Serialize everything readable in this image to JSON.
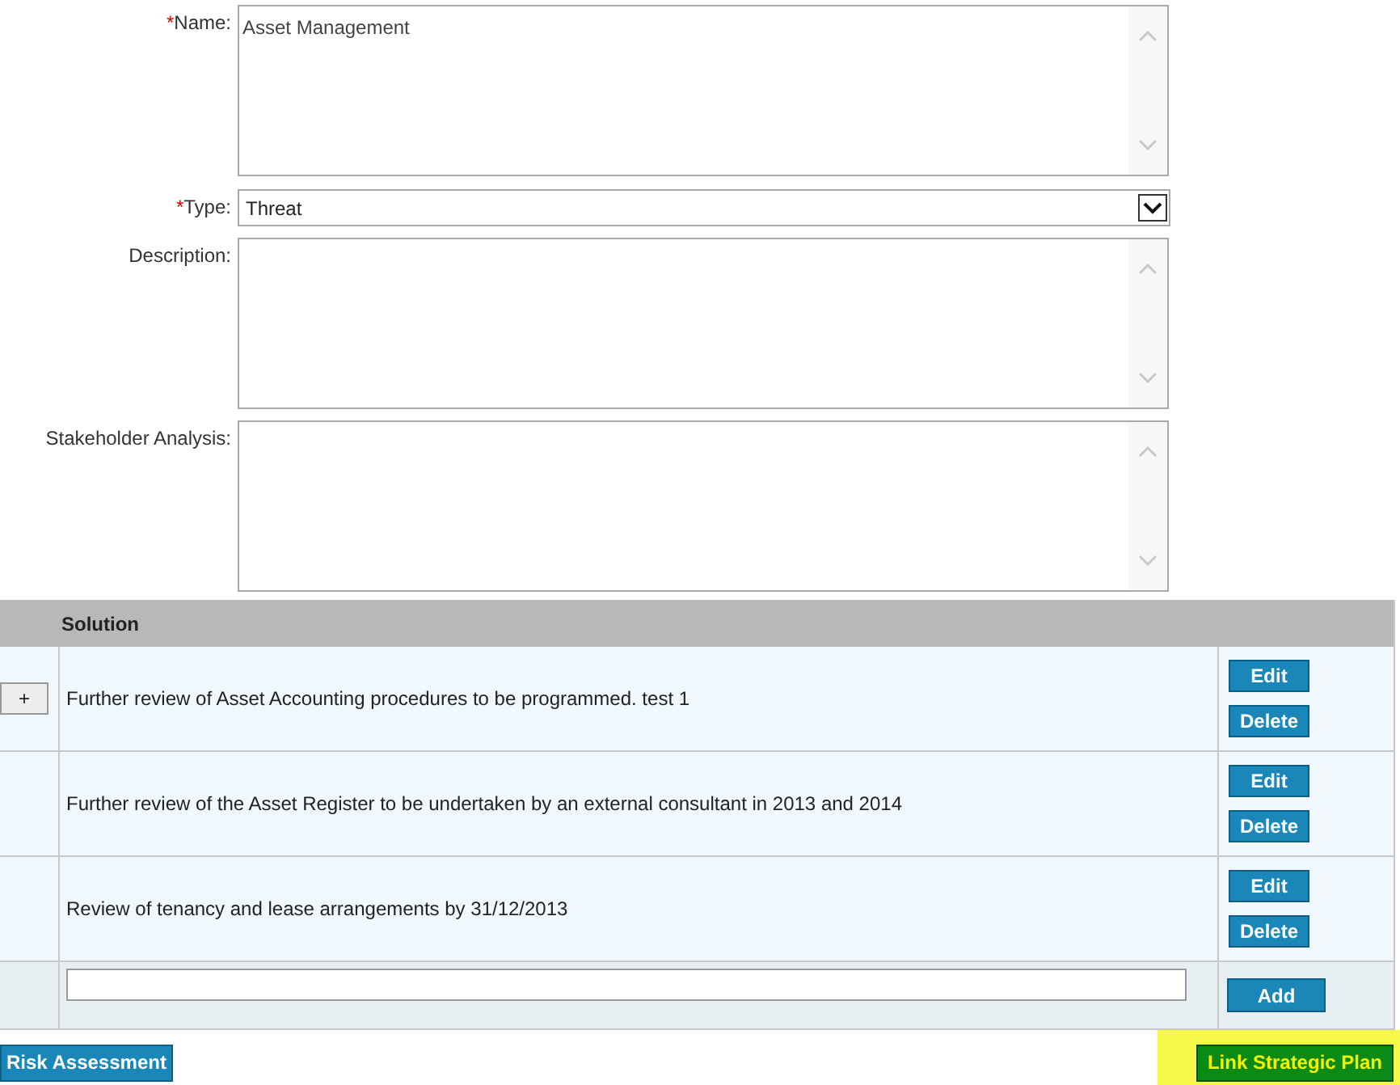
{
  "form": {
    "required_mark": "*",
    "fields": [
      {
        "kind": "textarea",
        "label": "Name:",
        "required": true,
        "value": "Asset Management"
      },
      {
        "kind": "select",
        "label": "Type:",
        "required": true,
        "value": "Threat"
      },
      {
        "kind": "textarea",
        "label": "Description:",
        "required": false
      },
      {
        "kind": "textarea",
        "label": "Stakeholder Analysis:",
        "required": false
      }
    ]
  },
  "table": {
    "columns": [
      "Solution"
    ],
    "rows": [
      {
        "expand_button": "+",
        "text": "Further review of Asset Accounting procedures to be programmed. test 1",
        "actions": [
          "Edit",
          "Delete"
        ]
      },
      {
        "text": "Further review of the Asset Register to be undertaken by an external consultant in 2013 and 2014",
        "actions": [
          "Edit",
          "Delete"
        ]
      },
      {
        "text": "Review of tenancy and lease arrangements by 31/12/2013",
        "actions": [
          "Edit",
          "Delete"
        ]
      }
    ],
    "add_row": {
      "button": "Add"
    }
  },
  "footer": {
    "left_button": {
      "label": "Risk Assessment"
    },
    "right_button": {
      "label": "Link Strategic Plan",
      "highlighted": true
    }
  }
}
